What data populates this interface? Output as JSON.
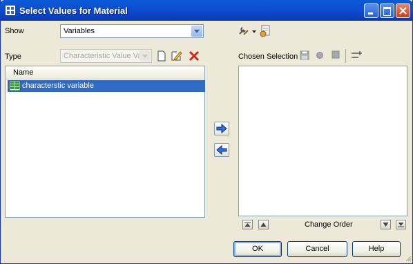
{
  "window": {
    "title": "Select Values for Material"
  },
  "show": {
    "label": "Show",
    "value": "Variables"
  },
  "type": {
    "label": "Type",
    "value": "Characteristic Value Va"
  },
  "available_list": {
    "column_header": "Name",
    "items": [
      {
        "label": "characterstic variable",
        "selected": true
      }
    ]
  },
  "chosen": {
    "label": "Chosen Selection",
    "items": []
  },
  "order": {
    "label": "Change Order"
  },
  "buttons": {
    "ok": "OK",
    "cancel": "Cancel",
    "help": "Help"
  },
  "icons": {
    "new": "new-document-icon",
    "edit": "edit-pencil-icon",
    "delete": "delete-x-icon",
    "tools": "tools-dropdown-icon",
    "properties": "properties-icon",
    "save": "save-icon",
    "record": "circle-icon",
    "stop": "square-icon",
    "sort": "sort-icon",
    "add": "arrow-right-icon",
    "remove": "arrow-left-icon"
  },
  "colors": {
    "title_bar": "#0a4fd1",
    "selection": "#316ac5",
    "window_bg": "#ece9d8"
  }
}
